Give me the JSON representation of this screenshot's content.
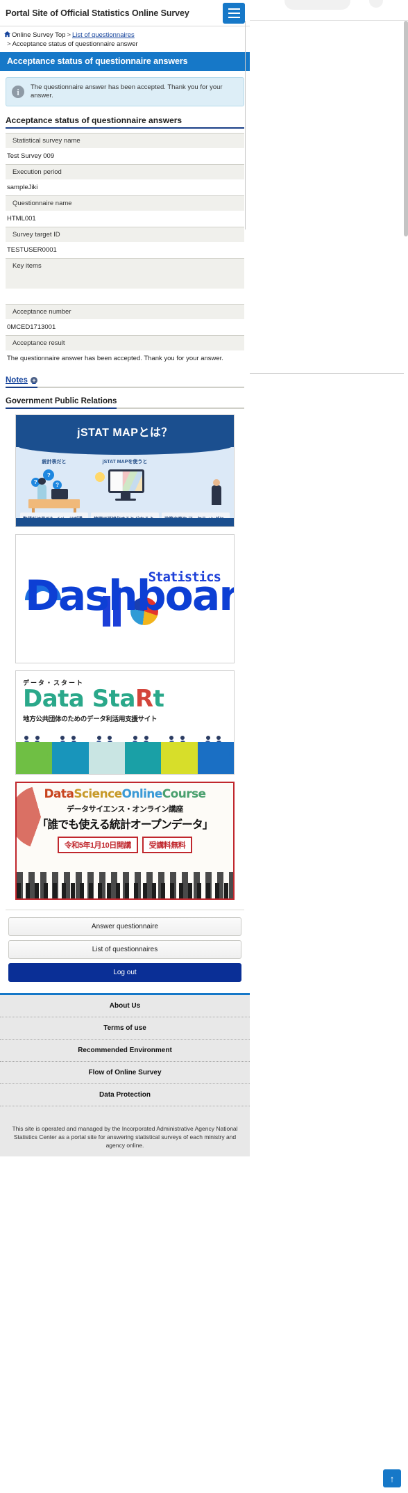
{
  "header": {
    "site_title": "Portal Site of Official Statistics Online Survey",
    "menu_icon": "hamburger-menu-icon"
  },
  "breadcrumb": {
    "home_icon": "home-icon",
    "item1": "Online Survey Top",
    "sep1": ">",
    "item2": "List of questionnaires",
    "sep2": ">",
    "item3": "Acceptance status of questionnaire answer"
  },
  "page_title": "Acceptance status of questionnaire answers",
  "info": {
    "icon": "info-icon",
    "message": "The questionnaire answer has been accepted. Thank you for your answer."
  },
  "section": {
    "heading": "Acceptance status of questionnaire answers"
  },
  "details": [
    {
      "label": "Statistical survey name",
      "value": "Test Survey 009"
    },
    {
      "label": "Execution period",
      "value": "sampleJiki"
    },
    {
      "label": "Questionnaire name",
      "value": "HTML001"
    },
    {
      "label": "Survey target ID",
      "value": "TESTUSER0001"
    },
    {
      "label": "Key items",
      "value": ""
    },
    {
      "label": "Acceptance number",
      "value": "0MCED1713001"
    },
    {
      "label": "Acceptance result",
      "value": "The questionnaire answer has been accepted. Thank you for your answer."
    }
  ],
  "notes": {
    "label": "Notes",
    "expand_icon": "plus-circle-icon"
  },
  "public_relations": {
    "heading": "Government Public Relations",
    "banners": [
      {
        "name": "jstat-map-banner",
        "title": "jSTAT MAPとは？",
        "col1_head": "統計表だと",
        "col2_head": "jSTAT MAPを使うと",
        "card1": "数値だけ見ても イメージが湧かない…",
        "card2": "地図で可視化すると 分かるように",
        "card3": "政策立案や マーケティングにも"
      },
      {
        "name": "dashboard-banner",
        "logo": "Dashboard",
        "sub": "Statistics"
      },
      {
        "name": "data-start-banner",
        "kana": "データ・スタート",
        "logo_a": "Data Sta",
        "logo_r": "R",
        "logo_b": "t",
        "sub": "地方公共団体のためのデータ利活用支援サイト"
      },
      {
        "name": "data-science-online-course-banner",
        "title_part1": "Data",
        "title_part2": "Science",
        "title_part3": "Online",
        "title_part4": "Course",
        "jp_line1": "データサイエンス・オンライン講座",
        "jp_line2": "「誰でも使える統計オープンデータ」",
        "badge1": "令和5年1月10日開講",
        "badge2": "受講料無料"
      }
    ]
  },
  "actions": {
    "answer": "Answer questionnaire",
    "list": "List of questionnaires",
    "logout": "Log out"
  },
  "footer": {
    "nav": [
      "About Us",
      "Terms of use",
      "Recommended Environment",
      "Flow of Online Survey",
      "Data Protection"
    ],
    "note": "This site is operated and managed by the Incorporated Administrative Agency National Statistics Center as a portal site for answering statistical surveys of each ministry and agency online.",
    "to_top_icon": "arrow-up-icon"
  },
  "colors": {
    "accent_blue": "#1678c8",
    "dark_blue": "#0a2f96",
    "heading_underline": "#1a3f87",
    "info_bg": "#ddeef7"
  }
}
